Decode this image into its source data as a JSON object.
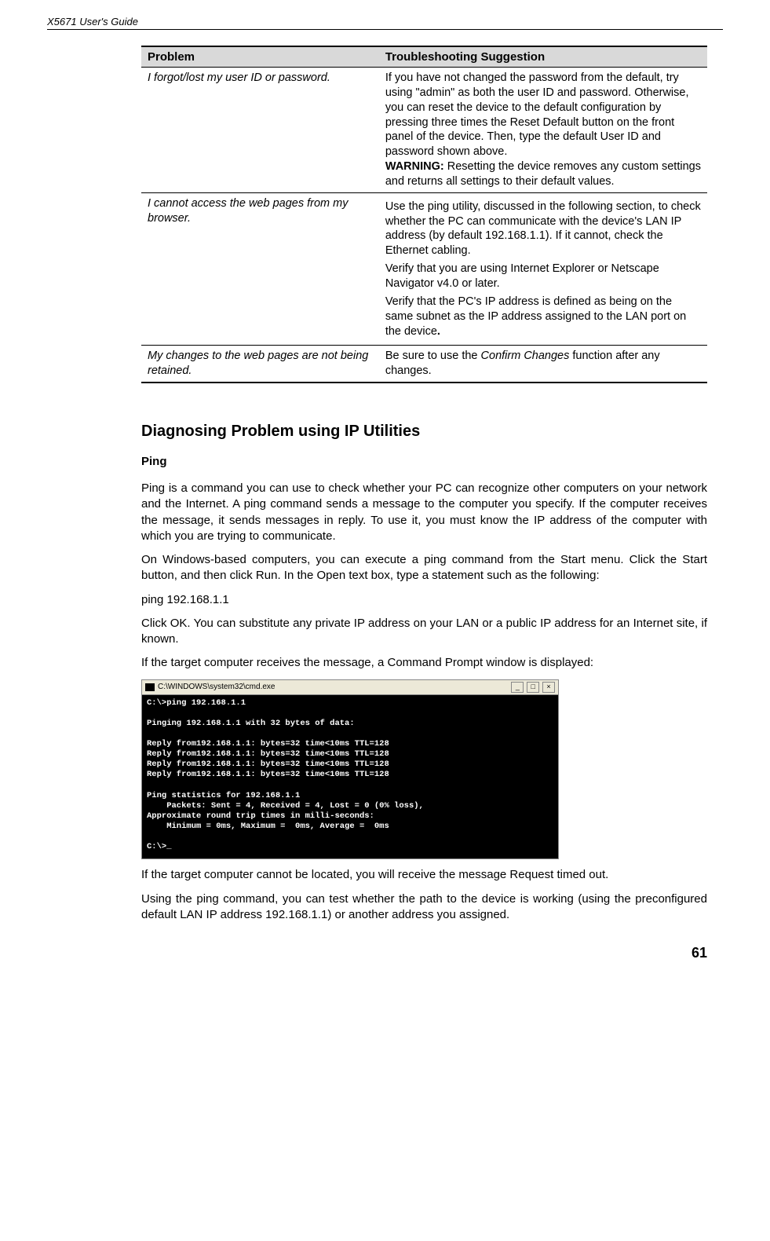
{
  "header": {
    "title": "X5671 User's Guide"
  },
  "table": {
    "head": {
      "problem": "Problem",
      "suggestion": "Troubleshooting Suggestion"
    },
    "rows": [
      {
        "problem": "I forgot/lost my user ID or password.",
        "suggestion_p1": "If you have not changed the password from the default, try using \"admin\" as both the user ID and password. Otherwise, you can reset the device to the default configuration by pressing three times the Reset Default button on the front panel of the device. Then, type the default User ID and password shown above.",
        "suggestion_p2_label": "WARNING:",
        "suggestion_p2_rest": " Resetting the device removes any custom settings and returns all settings to their default values."
      },
      {
        "problem": "I cannot access the web pages from my browser.",
        "suggestion_p1": "Use the ping utility, discussed in the following section, to check whether the PC can communicate with the device's LAN IP address (by default 192.168.1.1). If it cannot, check the Ethernet cabling.",
        "suggestion_p2": "Verify that you are using Internet Explorer or Netscape Navigator v4.0 or later.",
        "suggestion_p3a": "Verify that the PC's IP address is defined as being on the same subnet as the IP address assigned to the LAN port on the device",
        "suggestion_p3b": "."
      },
      {
        "problem": "My changes to the web pages are not being retained.",
        "suggestion_pre": "Be sure to use the ",
        "suggestion_em": "Confirm Changes",
        "suggestion_post": " function after any changes."
      }
    ]
  },
  "section": {
    "title": "Diagnosing Problem using IP Utilities",
    "ping_heading": "Ping",
    "p1": "Ping is a command you can use to check whether your PC can recognize other computers on your network and the Internet. A ping command sends a message to the computer you specify. If the computer receives the message, it sends messages in reply. To use it, you must know the IP address of the computer with which you are trying to communicate.",
    "p2": "On Windows-based computers, you can execute a ping command from the Start menu. Click the Start button, and then click Run. In the Open text box, type a statement such as the following:",
    "p3": "ping 192.168.1.1",
    "p4": "Click OK. You can substitute any private IP address on your LAN or a public IP address for an Internet site, if known.",
    "p5": "If the target computer receives the message, a Command Prompt window is displayed:",
    "p6": "If the target computer cannot be located, you will receive the message Request timed out.",
    "p7": "Using the ping command, you can test whether the path to the device is working (using the preconfigured default LAN IP address 192.168.1.1) or another address you assigned."
  },
  "cmd": {
    "title": "C:\\WINDOWS\\system32\\cmd.exe",
    "body": "C:\\>ping 192.168.1.1\n\nPinging 192.168.1.1 with 32 bytes of data:\n\nReply from192.168.1.1: bytes=32 time<10ms TTL=128\nReply from192.168.1.1: bytes=32 time<10ms TTL=128\nReply from192.168.1.1: bytes=32 time<10ms TTL=128\nReply from192.168.1.1: bytes=32 time<10ms TTL=128\n\nPing statistics for 192.168.1.1\n    Packets: Sent = 4, Received = 4, Lost = 0 (0% loss),\nApproximate round trip times in milli-seconds:\n    Minimum = 0ms, Maximum =  0ms, Average =  0ms\n\nC:\\>_"
  },
  "footer": {
    "page": "61"
  }
}
